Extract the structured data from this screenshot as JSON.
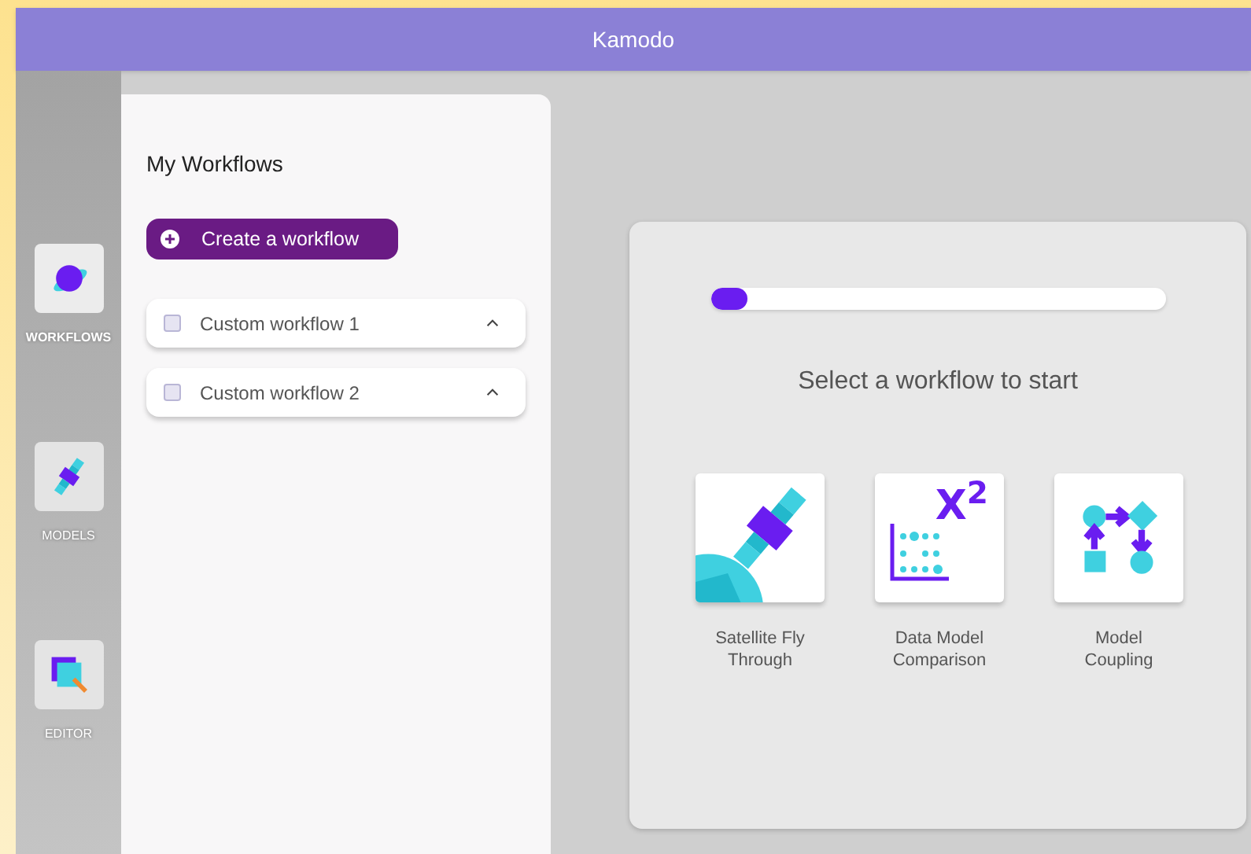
{
  "window": {
    "title": "Kamodo"
  },
  "sidebar": {
    "items": [
      {
        "label": "WORKFLOWS",
        "kind": "planet",
        "selected": true
      },
      {
        "label": "MODELS",
        "kind": "satellite",
        "selected": false
      },
      {
        "label": "EDITOR",
        "kind": "editor",
        "selected": false
      }
    ]
  },
  "workflows_panel": {
    "title": "My Workflows",
    "create_button": "Create a workflow",
    "items": [
      {
        "label": "Custom workflow 1",
        "checked": false,
        "expanded": true
      },
      {
        "label": "Custom workflow 2",
        "checked": false,
        "expanded": true
      }
    ]
  },
  "start_card": {
    "progress": {
      "level": 0.08
    },
    "prompt": "Select a workflow to start",
    "options": [
      {
        "kind": "satellite",
        "label": "Satellite Fly Through"
      },
      {
        "kind": "comparison",
        "label": "Data Model Comparison",
        "mark": "X$^{2}$"
      },
      {
        "kind": "coupling",
        "label": "Model Coupling"
      }
    ]
  }
}
